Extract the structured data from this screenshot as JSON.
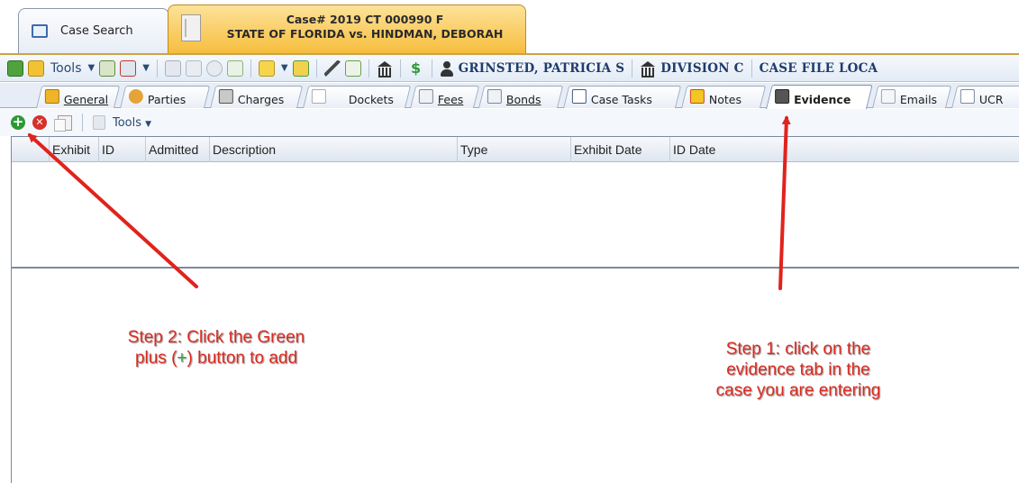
{
  "doc_tabs": {
    "search_label": "Case Search",
    "case_number": "Case# 2019 CT 000990 F",
    "case_title": "STATE OF FLORIDA vs. HINDMAN, DEBORAH"
  },
  "case_toolbar": {
    "tools_label": "Tools",
    "judge_name": "GRINSTED, PATRICIA S",
    "division": "DIVISION C",
    "case_file_location": "CASE FILE LOCA"
  },
  "record_tabs": [
    {
      "label": "General",
      "active": false
    },
    {
      "label": "Parties",
      "active": false
    },
    {
      "label": "Charges",
      "active": false
    },
    {
      "label": "Dockets",
      "active": false
    },
    {
      "label": "Fees",
      "active": false
    },
    {
      "label": "Bonds",
      "active": false
    },
    {
      "label": "Case Tasks",
      "active": false
    },
    {
      "label": "Notes",
      "active": false
    },
    {
      "label": "Evidence",
      "active": true
    },
    {
      "label": "Emails",
      "active": false
    },
    {
      "label": "UCR",
      "active": false
    }
  ],
  "evidence_toolbar": {
    "tools_label": "Tools"
  },
  "grid": {
    "columns": [
      "Exhibit",
      "ID",
      "Admitted",
      "Description",
      "Type",
      "Exhibit Date",
      "ID Date"
    ],
    "rows": []
  },
  "annotations": {
    "step2_line1": "Step 2: Click the Green",
    "step2_line2_a": "plus (",
    "step2_plus": "+",
    "step2_line2_b": ")  button to add",
    "step1_line1": "Step 1: click on the",
    "step1_line2": "evidence tab in the",
    "step1_line3": "case you are entering",
    "arrow_color": "#e0231c"
  },
  "colors": {
    "active_case_tab": "#f6bd3c",
    "add_button": "#2b9a34",
    "delete_button": "#d6312b",
    "header_text": "#1f3c6a"
  }
}
